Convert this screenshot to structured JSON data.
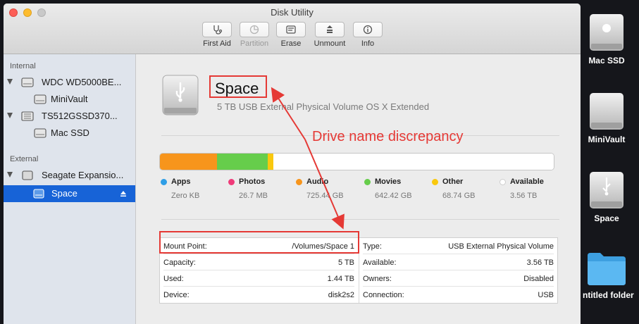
{
  "window": {
    "title": "Disk Utility"
  },
  "toolbar": {
    "first_aid": "First Aid",
    "partition": "Partition",
    "erase": "Erase",
    "unmount": "Unmount",
    "info": "Info"
  },
  "sidebar": {
    "internal_header": "Internal",
    "external_header": "External",
    "items": [
      {
        "label": "WDC WD5000BE...",
        "level": 0
      },
      {
        "label": "MiniVault",
        "level": 1
      },
      {
        "label": "TS512GSSD370...",
        "level": 0
      },
      {
        "label": "Mac SSD",
        "level": 1
      },
      {
        "label": "Seagate Expansio...",
        "level": 0
      },
      {
        "label": "Space",
        "level": 1,
        "selected": true
      }
    ]
  },
  "drive": {
    "name": "Space",
    "description": "5 TB USB External Physical Volume OS X Extended"
  },
  "usage": {
    "capacity": "5 TB",
    "categories": [
      {
        "name": "Apps",
        "size": "Zero KB",
        "color": "#2e9ee6",
        "fraction": 0.0
      },
      {
        "name": "Photos",
        "size": "26.7 MB",
        "color": "#ef3b79",
        "fraction": 0.0
      },
      {
        "name": "Audio",
        "size": "725.44 GB",
        "color": "#f7951c",
        "fraction": 0.145
      },
      {
        "name": "Movies",
        "size": "642.42 GB",
        "color": "#66cd4b",
        "fraction": 0.128
      },
      {
        "name": "Other",
        "size": "68.74 GB",
        "color": "#f9c80e",
        "fraction": 0.014
      },
      {
        "name": "Available",
        "size": "3.56 TB",
        "color": "#ffffff",
        "fraction": 0.713
      }
    ]
  },
  "details": {
    "left": [
      {
        "key": "Mount Point:",
        "value": "/Volumes/Space 1"
      },
      {
        "key": "Capacity:",
        "value": "5 TB"
      },
      {
        "key": "Used:",
        "value": "1.44 TB"
      },
      {
        "key": "Device:",
        "value": "disk2s2"
      }
    ],
    "right": [
      {
        "key": "Type:",
        "value": "USB External Physical Volume"
      },
      {
        "key": "Available:",
        "value": "3.56 TB"
      },
      {
        "key": "Owners:",
        "value": "Disabled"
      },
      {
        "key": "Connection:",
        "value": "USB"
      }
    ]
  },
  "desktop": {
    "icons": [
      {
        "label": "Mac SSD",
        "icon": "hard-drive-apple-icon"
      },
      {
        "label": "MiniVault",
        "icon": "hard-drive-icon"
      },
      {
        "label": "Space",
        "icon": "usb-drive-icon"
      },
      {
        "label": "ntitled folder",
        "icon": "folder-icon"
      }
    ]
  },
  "annotation": {
    "text": "Drive name discrepancy",
    "color": "#e53935"
  }
}
